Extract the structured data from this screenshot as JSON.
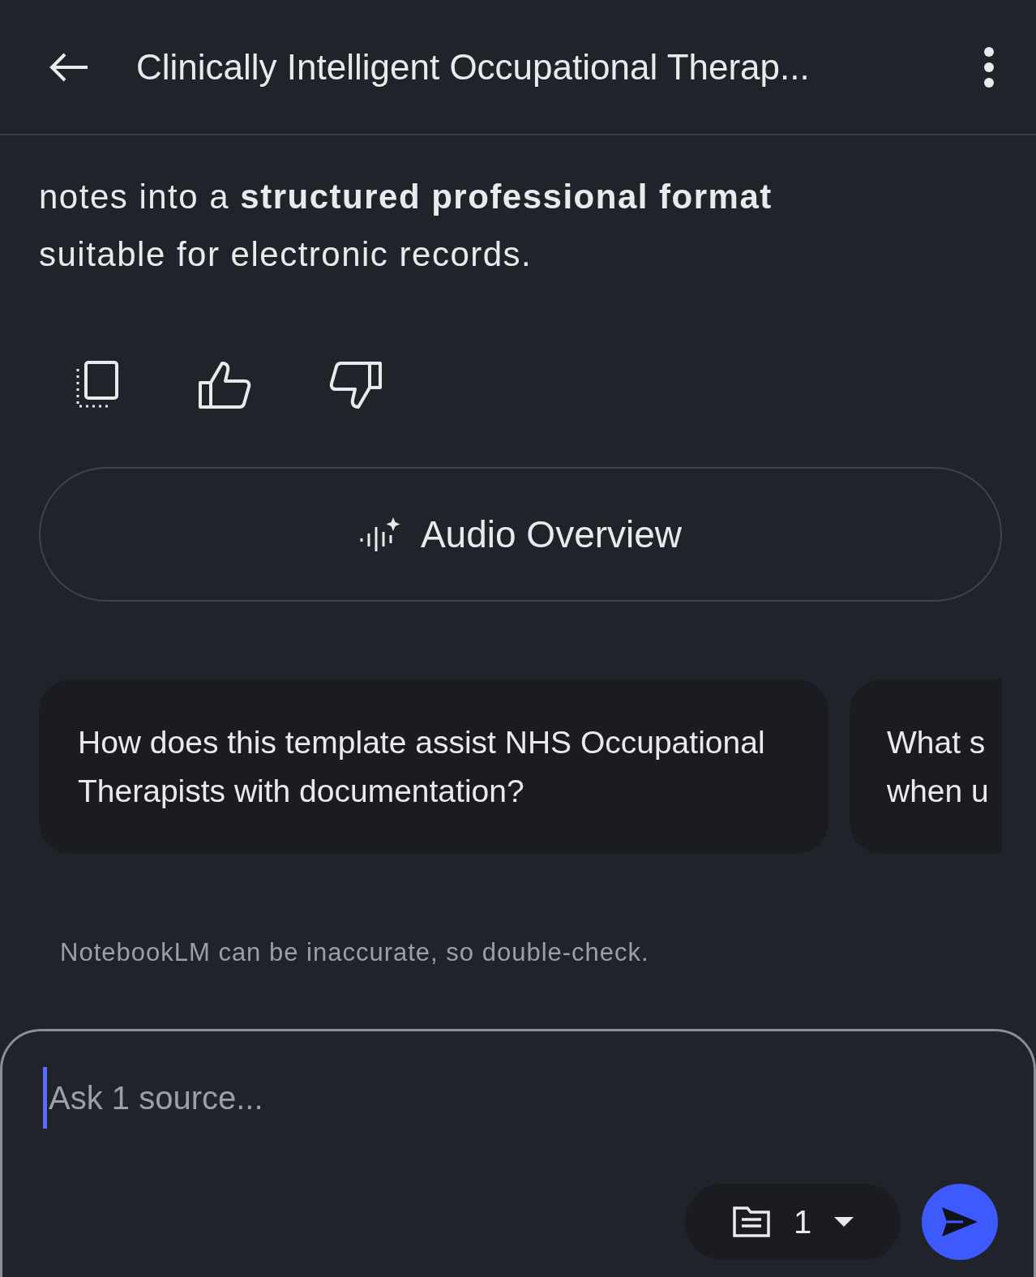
{
  "header": {
    "title": "Clinically Intelligent Occupational Therap..."
  },
  "answer": {
    "text": "notes into a **structured professional format** suitable for electronic records."
  },
  "audio_button": {
    "label": "Audio Overview"
  },
  "suggestions": [
    {
      "text": "How does this template assist NHS Occupational Therapists with documentation?"
    },
    {
      "text": "What s\nwhen u"
    }
  ],
  "disclaimer": "NotebookLM can be inaccurate, so double-check.",
  "composer": {
    "placeholder": "Ask 1 source...",
    "source_count": "1"
  }
}
